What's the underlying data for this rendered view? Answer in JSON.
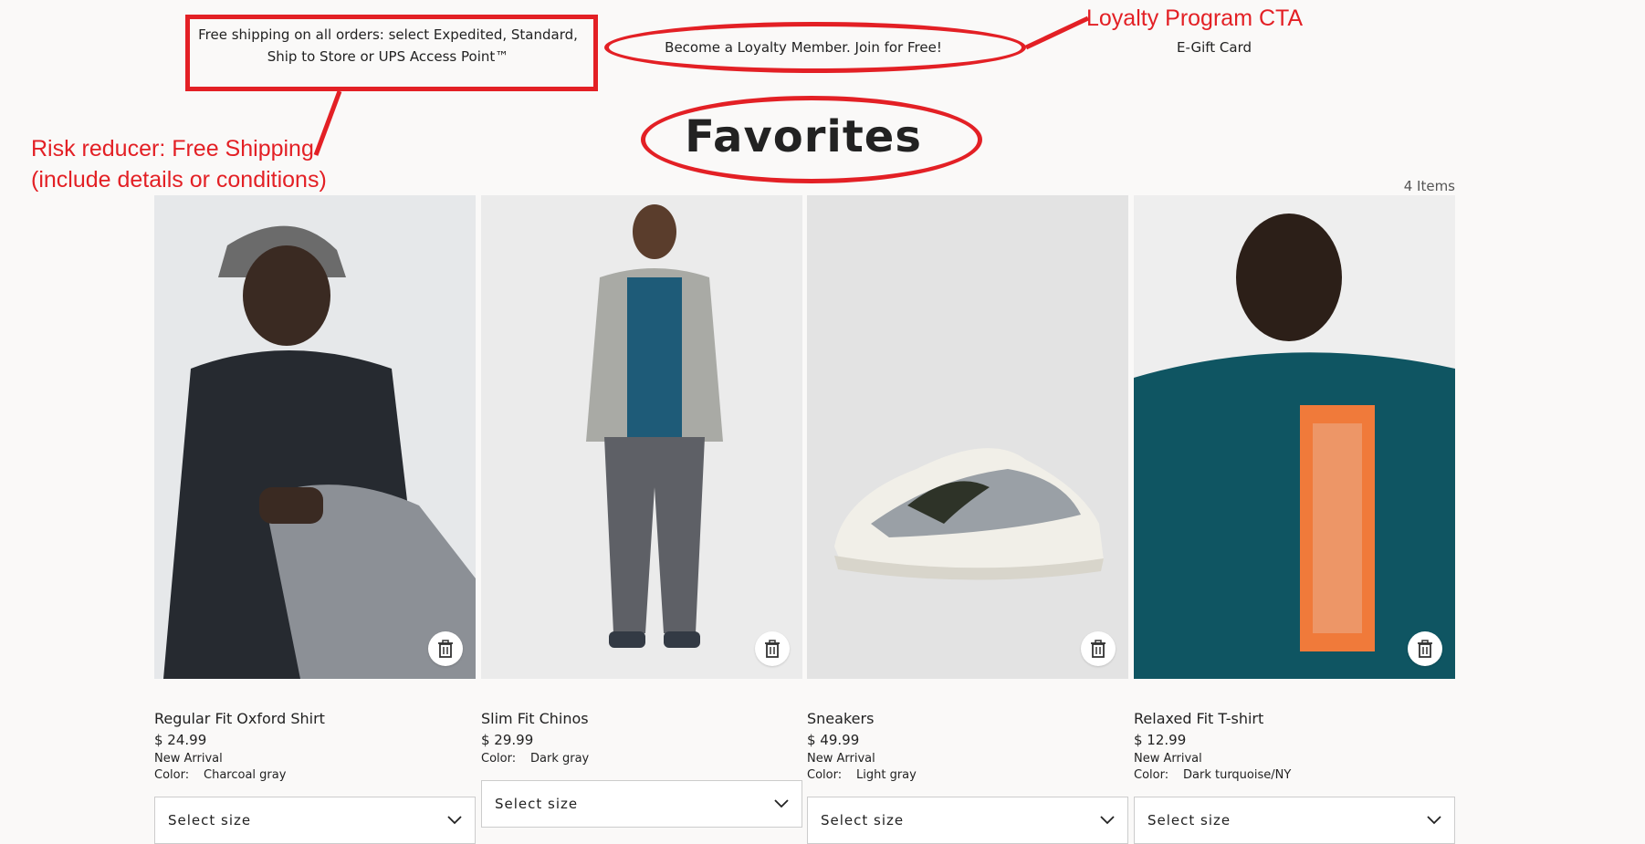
{
  "header": {
    "shipping_line1": "Free shipping on all orders: select Expedited, Standard,",
    "shipping_line2": "Ship to Store or UPS Access Point™",
    "loyalty": "Become a Loyalty Member. Join for Free!",
    "egift": "E-Gift Card"
  },
  "page": {
    "title": "Favorites",
    "item_count": "4 Items"
  },
  "annotations": {
    "loyalty_label": "Loyalty Program CTA",
    "risk_line1": "Risk reducer: Free Shipping",
    "risk_line2": "(include details or conditions)",
    "color": "#e32025"
  },
  "products": [
    {
      "name": "Regular Fit Oxford Shirt",
      "price": "$ 24.99",
      "badge": "New Arrival",
      "color_label": "Color:",
      "color_value": "Charcoal gray",
      "select_label": "Select size"
    },
    {
      "name": "Slim Fit Chinos",
      "price": "$ 29.99",
      "badge": "",
      "color_label": "Color:",
      "color_value": "Dark gray",
      "select_label": "Select size"
    },
    {
      "name": "Sneakers",
      "price": "$ 49.99",
      "badge": "New Arrival",
      "color_label": "Color:",
      "color_value": "Light gray",
      "select_label": "Select size"
    },
    {
      "name": "Relaxed Fit T-shirt",
      "price": "$ 12.99",
      "badge": "New Arrival",
      "color_label": "Color:",
      "color_value": "Dark turquoise/NY",
      "select_label": "Select size"
    }
  ],
  "icons": {
    "remove": "trash-icon",
    "dropdown": "chevron-down-icon"
  }
}
